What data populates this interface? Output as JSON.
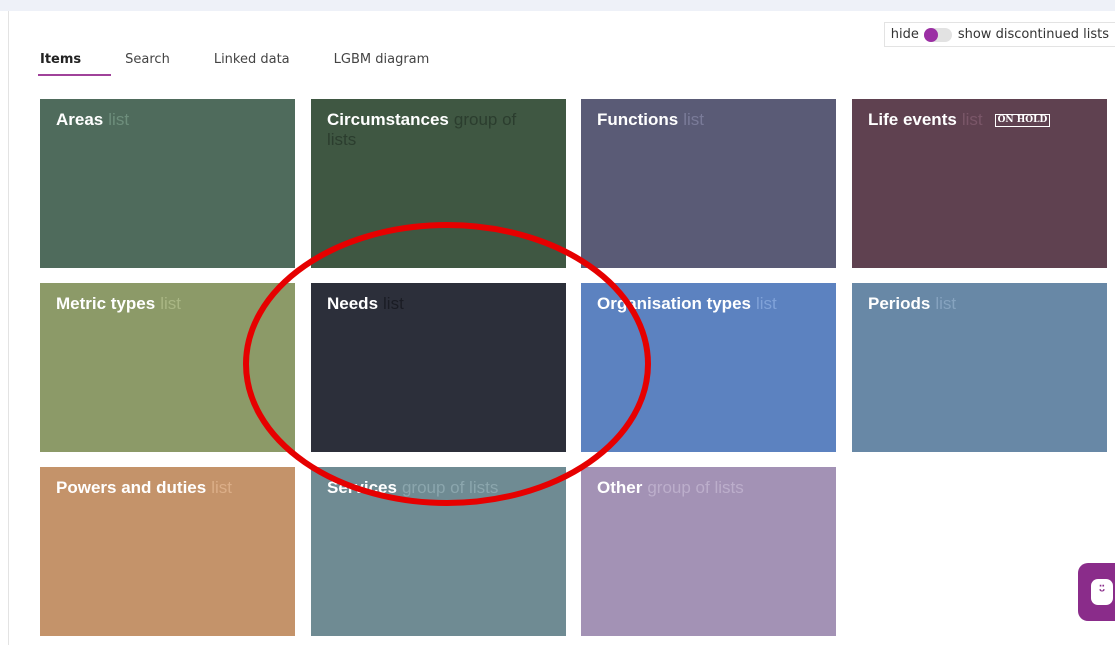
{
  "toggle": {
    "hide_label": "hide",
    "show_label": "show discontinued lists",
    "state": "hide",
    "accent": "#9b2fa4"
  },
  "tabs": [
    {
      "label": "Items",
      "active": true
    },
    {
      "label": "Search",
      "active": false
    },
    {
      "label": "Linked data",
      "active": false
    },
    {
      "label": "LGBM diagram",
      "active": false
    }
  ],
  "tiles": [
    {
      "title": "Areas",
      "kind": "list",
      "bg": "#4f6b5c",
      "kind_color": "#6e8e7c"
    },
    {
      "title": "Circumstances",
      "kind": "group of lists",
      "bg": "#3f5742",
      "kind_color": "#2b3d2e"
    },
    {
      "title": "Functions",
      "kind": "list",
      "bg": "#5a5b76",
      "kind_color": "#7a7b99"
    },
    {
      "title": "Life events",
      "kind": "list",
      "badge": "ON HOLD",
      "bg": "#5f4150",
      "kind_color": "#7a5668"
    },
    {
      "title": "Metric types",
      "kind": "list",
      "bg": "#8c9a68",
      "kind_color": "#a9b684"
    },
    {
      "title": "Needs",
      "kind": "list",
      "bg": "#2c2f3a",
      "kind_color": "#1a1c24"
    },
    {
      "title": "Organisation types",
      "kind": "list",
      "bg": "#5c82c0",
      "kind_color": "#80a2d8"
    },
    {
      "title": "Periods",
      "kind": "list",
      "bg": "#6888a6",
      "kind_color": "#86a3bf"
    },
    {
      "title": "Powers and duties",
      "kind": "list",
      "bg": "#c4936a",
      "kind_color": "#dbae88"
    },
    {
      "title": "Services",
      "kind": "group of lists",
      "bg": "#6f8b93",
      "kind_color": "#8ba6ad"
    },
    {
      "title": "Other",
      "kind": "group of lists",
      "bg": "#a392b5",
      "kind_color": "#bcaecb"
    }
  ],
  "annotation_color": "#e60000",
  "chat": {
    "icon": "chat-bot-icon",
    "glyph": "ᵕ̈",
    "color": "#8a2c8a"
  }
}
